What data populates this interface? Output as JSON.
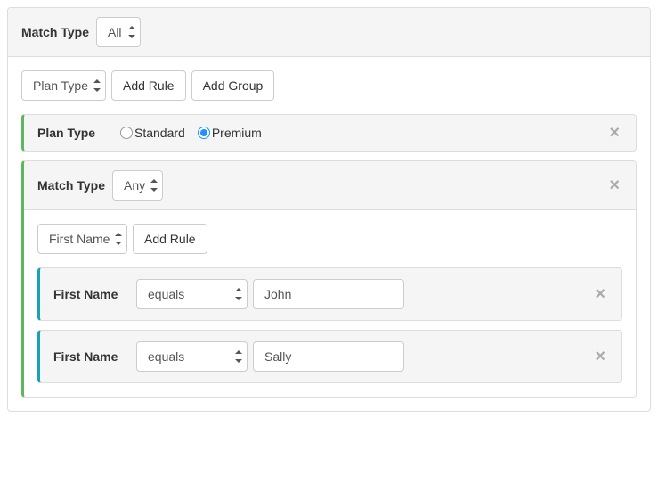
{
  "root": {
    "match_type_label": "Match Type",
    "match_type_value": "All",
    "rule_type_value": "Plan Type",
    "add_rule_label": "Add Rule",
    "add_group_label": "Add Group"
  },
  "rule1": {
    "field_label": "Plan Type",
    "options": [
      {
        "label": "Standard",
        "checked": false
      },
      {
        "label": "Premium",
        "checked": true
      }
    ]
  },
  "group1": {
    "match_type_label": "Match Type",
    "match_type_value": "Any",
    "rule_type_value": "First Name",
    "add_rule_label": "Add Rule",
    "rules": [
      {
        "field_label": "First Name",
        "operator": "equals",
        "value": "John"
      },
      {
        "field_label": "First Name",
        "operator": "equals",
        "value": "Sally"
      }
    ]
  }
}
